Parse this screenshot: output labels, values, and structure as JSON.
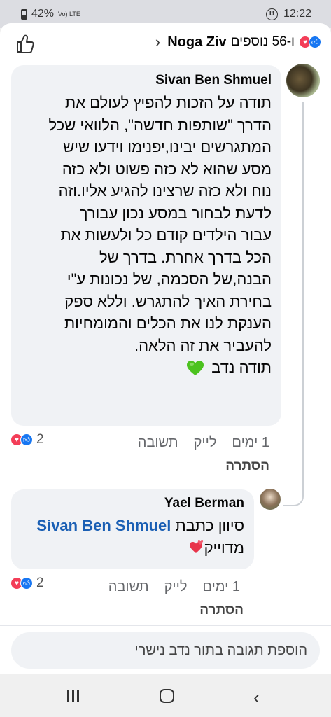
{
  "status_bar": {
    "battery": "42%",
    "signal_text": "Vo) LTE",
    "time": "12:22"
  },
  "header": {
    "title_name": "Noga Ziv",
    "title_others": "ו-56 נוספים",
    "chevron": "›"
  },
  "comments": [
    {
      "author": "Sivan Ben Shmuel",
      "lines": [
        "תודה על הזכות להפיץ לעולם את",
        "הדרך \"שותפות חדשה\", הלוואי שכל",
        "המתגרשים יבינו,יפנימו וידעו שיש",
        "מסע שהוא לא כזה פשוט ולא כזה",
        "נוח ולא כזה שרצינו להגיע אליו.וזה",
        "לדעת לבחור במסע נכון עבורך",
        "עבור הילדים קודם כל ולעשות את",
        "הכל בדרך אחרת. בדרך של",
        "הבנה,של הסכמה, של נכונות ע\"י",
        "בחירת האיך להתגרש. וללא ספק",
        "הענקת לנו את הכלים והמומחיות",
        "להעביר את זה הלאה."
      ],
      "closing": "תודה נדב",
      "time": "1 ימים",
      "like": "לייק",
      "reply": "תשובה",
      "hide": "הסתרה",
      "reaction_count": "2"
    },
    {
      "author": "Yael Berman",
      "line1_prefix": "סיוון כתבת",
      "mention": "Sivan Ben Shmuel",
      "line2": "מדוייק",
      "time": "1 ימים",
      "like": "לייק",
      "reply": "תשובה",
      "hide": "הסתרה",
      "reaction_count": "2"
    }
  ],
  "composer": {
    "placeholder": "הוספת תגובה בתור נדב נישרי"
  },
  "colors": {
    "love": "#f33e58",
    "like": "#1877f2",
    "mention": "#1a5fb4",
    "green_heart": "#4cc21f"
  },
  "icons": [
    "like-outline-icon",
    "chevron-right-icon",
    "green-heart-icon",
    "red-heart-icon",
    "love-reaction-icon",
    "like-reaction-icon",
    "recent-apps-icon",
    "home-icon",
    "back-icon"
  ]
}
